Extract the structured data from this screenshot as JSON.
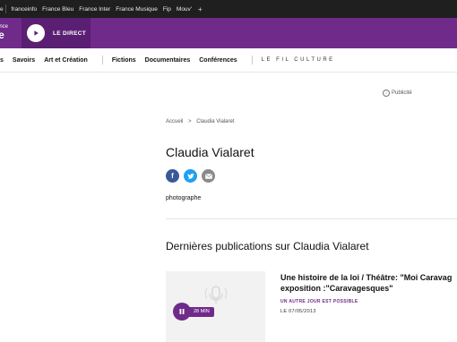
{
  "network": {
    "first_partial": "e",
    "links": [
      "franceinfo",
      "France Bleu",
      "France Inter",
      "France Musique",
      "Fip",
      "Mouv'"
    ],
    "more": "+"
  },
  "brand": {
    "logo_top": "ance",
    "logo_main": "re",
    "direct_label": "LE DIRECT",
    "colors": {
      "purple": "#6f2a8a",
      "purple_dark": "#5a1f72"
    }
  },
  "nav": {
    "items": [
      "s",
      "Savoirs",
      "Art et Création",
      "Fictions",
      "Documentaires",
      "Conférences"
    ],
    "fil": "LE FIL CULTURE"
  },
  "ad": {
    "label": "Publicité"
  },
  "breadcrumb": {
    "home": "Accueil",
    "sep": ">",
    "current": "Claudia Vialaret"
  },
  "profile": {
    "name": "Claudia Vialaret",
    "description": "photographe",
    "share": [
      {
        "icon": "facebook-icon",
        "glyph": "f",
        "color": "#3b5998"
      },
      {
        "icon": "twitter-icon",
        "glyph": "t",
        "color": "#1da1f2"
      },
      {
        "icon": "email-icon",
        "glyph": "✉",
        "color": "#8a8a8a"
      }
    ]
  },
  "publications": {
    "heading": "Dernières publications sur Claudia Vialaret",
    "items": [
      {
        "title_line1": "Une histoire de la loi / Théâtre: \"Moi Caravag",
        "title_line2": "exposition :\"Caravagesques\"",
        "show": "UN AUTRE JOUR EST POSSIBLE",
        "date": "LE 07/05/2013",
        "duration": "28 MIN"
      }
    ]
  }
}
